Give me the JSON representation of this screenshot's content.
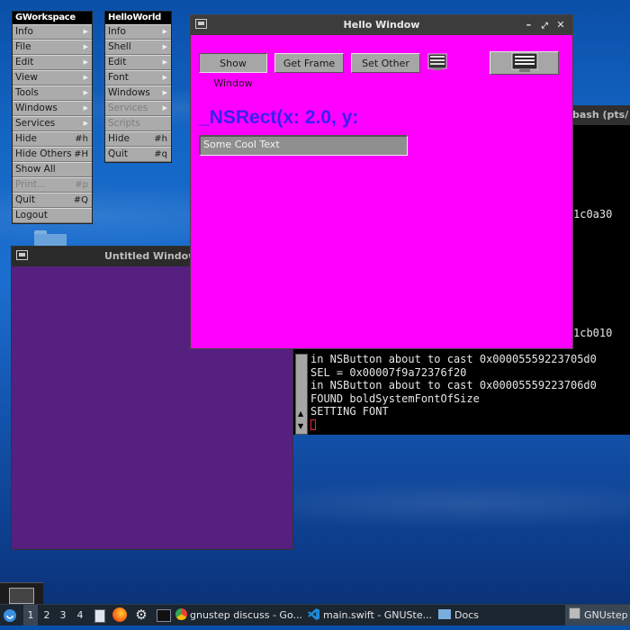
{
  "gworkspace_menu": {
    "title": "GWorkspace",
    "items": [
      {
        "label": "Info",
        "submenu": true
      },
      {
        "label": "File",
        "submenu": true
      },
      {
        "label": "Edit",
        "submenu": true
      },
      {
        "label": "View",
        "submenu": true
      },
      {
        "label": "Tools",
        "submenu": true
      },
      {
        "label": "Windows",
        "submenu": true
      },
      {
        "label": "Services",
        "submenu": true
      },
      {
        "label": "Hide",
        "key": "#h"
      },
      {
        "label": "Hide Others",
        "key": "#H"
      },
      {
        "label": "Show All"
      },
      {
        "label": "Print...",
        "key": "#p",
        "disabled": true
      },
      {
        "label": "Quit",
        "key": "#Q"
      },
      {
        "label": "Logout"
      }
    ]
  },
  "helloworld_menu": {
    "title": "HelloWorld",
    "items": [
      {
        "label": "Info",
        "submenu": true
      },
      {
        "label": "Shell",
        "submenu": true
      },
      {
        "label": "Edit",
        "submenu": true
      },
      {
        "label": "Font",
        "submenu": true
      },
      {
        "label": "Windows",
        "submenu": true
      },
      {
        "label": "Services",
        "submenu": true,
        "disabled": true
      },
      {
        "label": "Scripts",
        "disabled": true
      },
      {
        "label": "Hide",
        "key": "#h"
      },
      {
        "label": "Quit",
        "key": "#q"
      }
    ]
  },
  "untitled_window": {
    "title": "Untitled Window"
  },
  "hello_window": {
    "title": "Hello Window",
    "buttons": {
      "show_window": "Show Window",
      "get_frame": "Get Frame",
      "set_other": "Set Other"
    },
    "heading": "_NSRect(x: 2.0, y:",
    "text_field": "Some Cool Text",
    "colors": {
      "background": "#ff00ff",
      "heading": "#3b1ff0"
    }
  },
  "terminal": {
    "title": "bash (pts/",
    "partial_lines": [
      "1c0a30",
      "1cb010"
    ],
    "lines": [
      "in NSButton about to cast 0x00005559223705d0",
      "SEL = 0x00007f9a72376f20",
      "in NSButton about to cast 0x00005559223706d0",
      "FOUND boldSystemFontOfSize",
      "SETTING FONT"
    ]
  },
  "taskbar": {
    "workspaces": [
      "1",
      "2",
      "3",
      "4"
    ],
    "tasks": [
      "gnustep discuss - Go...",
      "main.swift - GNUSte...",
      "Docs"
    ],
    "right_task": "GNUstep"
  }
}
